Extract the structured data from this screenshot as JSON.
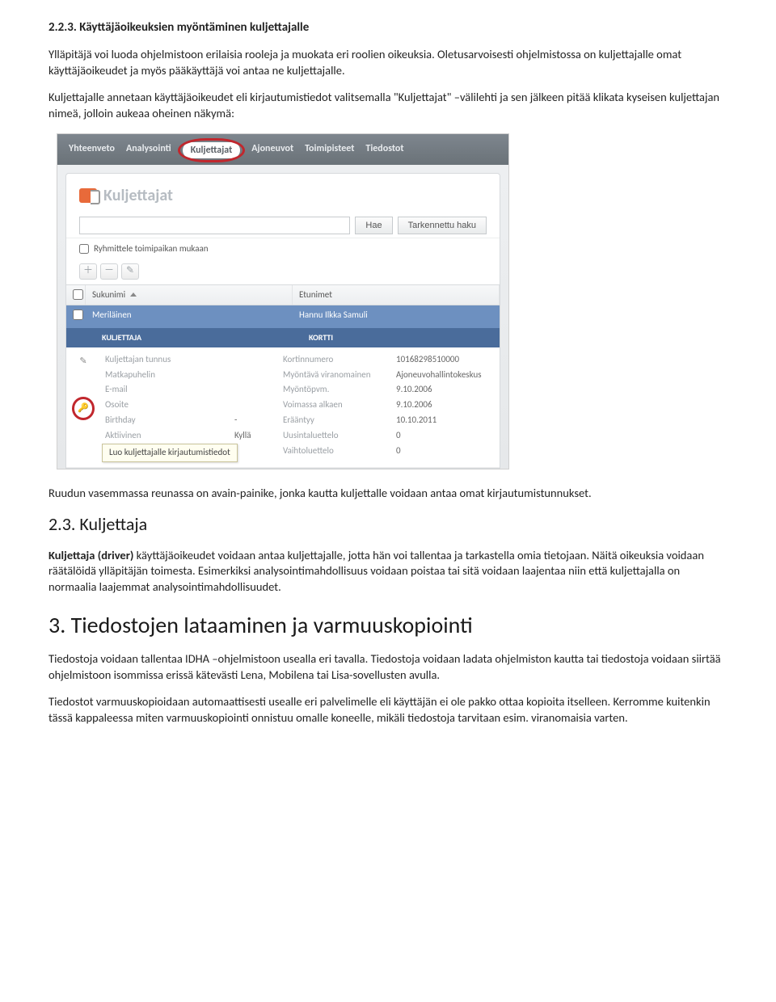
{
  "sec223": {
    "heading": "2.2.3.  Käyttäjäoikeuksien myöntäminen kuljettajalle",
    "p1": "Ylläpitäjä voi luoda ohjelmistoon erilaisia rooleja ja muokata eri roolien oikeuksia. Oletusarvoisesti ohjelmistossa on kuljettajalle omat käyttäjäoikeudet ja myös pääkäyttäjä voi antaa ne kuljettajalle.",
    "p2": "Kuljettajalle annetaan käyttäjäoikeudet eli kirjautumistiedot valitsemalla \"Kuljettajat\" –välilehti ja sen jälkeen pitää klikata kyseisen kuljettajan nimeä, jolloin aukeaa oheinen näkymä:",
    "after": "Ruudun vasemmassa reunassa on avain-painike, jonka kautta kuljettalle voidaan antaa omat kirjautumistunnukset."
  },
  "sec23": {
    "heading": "2.3. Kuljettaja",
    "p1a": "Kuljettaja (driver)",
    "p1b": " käyttäjäoikeudet voidaan antaa kuljettajalle, jotta hän voi tallentaa ja tarkastella omia tietojaan. Näitä oikeuksia voidaan räätälöidä ylläpitäjän toimesta.  Esimerkiksi analysointimahdollisuus voidaan poistaa tai sitä voidaan laajentaa niin että kuljettajalla on normaalia laajemmat analysointimahdollisuudet."
  },
  "sec3": {
    "heading": "3. Tiedostojen lataaminen ja varmuuskopiointi",
    "p1": "Tiedostoja voidaan tallentaa IDHA –ohjelmistoon usealla eri tavalla. Tiedostoja voidaan ladata ohjelmiston kautta tai tiedostoja voidaan siirtää ohjelmistoon isommissa erissä kätevästi Lena, Mobilena tai Lisa-sovellusten avulla.",
    "p2": "Tiedostot varmuuskopioidaan automaattisesti usealle eri palvelimelle eli käyttäjän ei ole pakko ottaa kopioita itselleen. Kerromme kuitenkin tässä kappaleessa miten varmuuskopiointi onnistuu omalle koneelle, mikäli tiedostoja tarvitaan esim. viranomaisia varten."
  },
  "shot": {
    "tabs": [
      "Yhteenveto",
      "Analysointi",
      "Kuljettajat",
      "Ajoneuvot",
      "Toimipisteet",
      "Tiedostot"
    ],
    "panel_title": "Kuljettajat",
    "btn_search": "Hae",
    "btn_advanced": "Tarkennettu haku",
    "chk_group": "Ryhmittele toimipaikan mukaan",
    "col_surname": "Sukunimi",
    "col_firstnames": "Etunimet",
    "row_surname": "Meriläinen",
    "row_firstnames": "Hannu Ilkka Samuli",
    "sub_left": "KULJETTAJA",
    "sub_right": "KORTTI",
    "left": {
      "l1": "Kuljettajan tunnus",
      "v1": "",
      "l2": "Matkapuhelin",
      "v2": "",
      "l3": "E-mail",
      "v3": "",
      "l4": "Osoite",
      "v4": "",
      "l5": "Birthday",
      "v5": "-",
      "l6": "Aktiivinen",
      "v6": "Kyllä"
    },
    "right": {
      "l1": "Kortinnumero",
      "v1": "10168298510000",
      "l2": "Myöntävä viranomainen",
      "v2": "Ajoneuvohallintokeskus",
      "l3": "Myöntöpvm.",
      "v3": "9.10.2006",
      "l4": "Voimassa alkaen",
      "v4": "9.10.2006",
      "l5": "Erääntyy",
      "v5": "10.10.2011",
      "l6": "Uusintaluettelo",
      "v6": "0",
      "l7": "Vaihtoluettelo",
      "v7": "0"
    },
    "tooltip": "Luo kuljettajalle kirjautumistiedot"
  }
}
